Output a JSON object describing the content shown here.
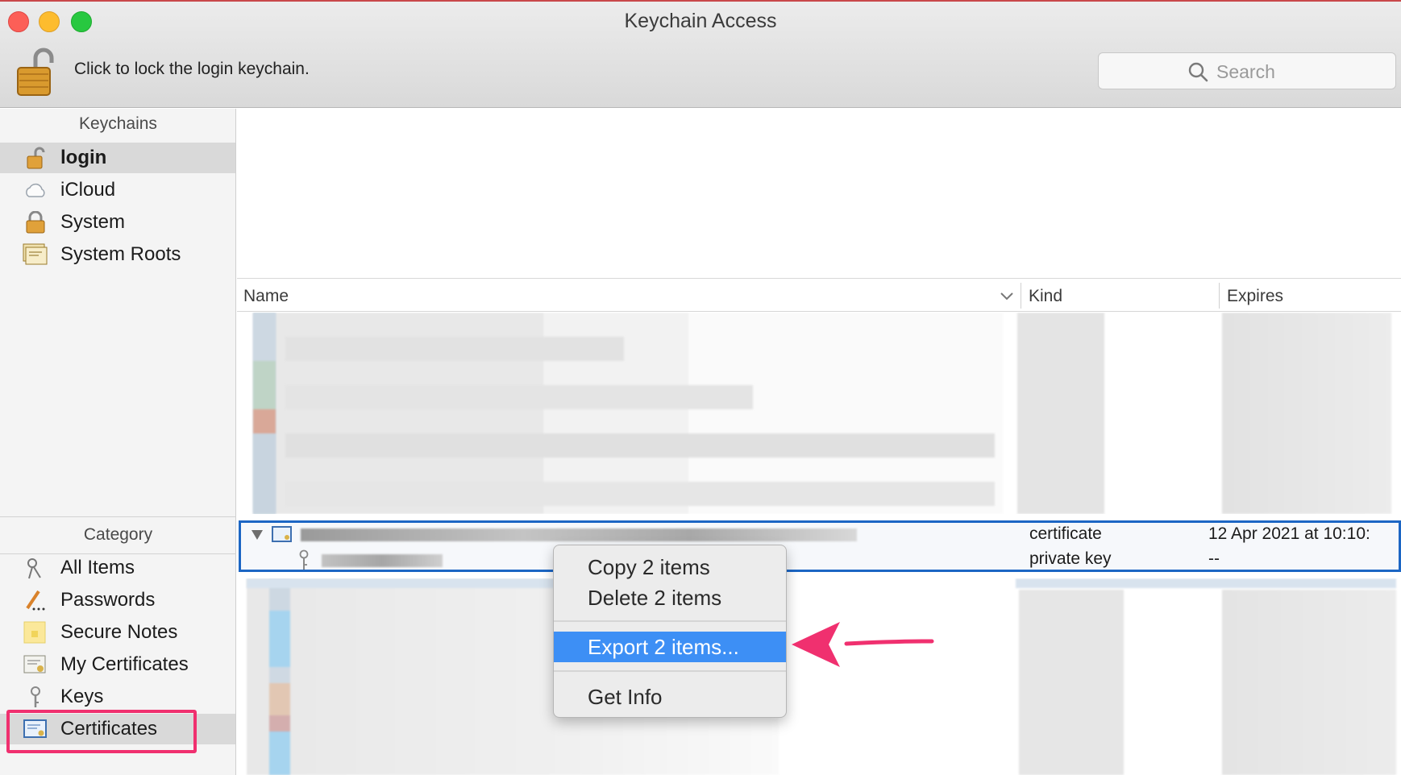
{
  "window": {
    "title": "Keychain Access"
  },
  "toolbar": {
    "lock_text": "Click to lock the login keychain.",
    "search_placeholder": "Search"
  },
  "sidebar": {
    "keychains_header": "Keychains",
    "keychains": [
      {
        "label": "login",
        "icon": "unlocked-padlock-icon",
        "active": true
      },
      {
        "label": "iCloud",
        "icon": "cloud-icon"
      },
      {
        "label": "System",
        "icon": "padlock-icon"
      },
      {
        "label": "System Roots",
        "icon": "certificate-stack-icon"
      }
    ],
    "category_header": "Category",
    "categories": [
      {
        "label": "All Items",
        "icon": "all-items-icon"
      },
      {
        "label": "Passwords",
        "icon": "pen-icon"
      },
      {
        "label": "Secure Notes",
        "icon": "note-icon"
      },
      {
        "label": "My Certificates",
        "icon": "my-certificate-icon"
      },
      {
        "label": "Keys",
        "icon": "key-icon"
      },
      {
        "label": "Certificates",
        "icon": "certificate-icon",
        "selected": true
      }
    ]
  },
  "table": {
    "columns": [
      "Name",
      "Kind",
      "Expires"
    ],
    "selected_rows": [
      {
        "kind": "certificate",
        "expires": "12 Apr 2021 at 10:10:"
      },
      {
        "kind": "private key",
        "expires": "--"
      }
    ]
  },
  "context_menu": {
    "items": [
      "Copy 2 items",
      "Delete 2 items",
      "Export 2 items...",
      "Get Info"
    ],
    "highlighted": "Export 2 items..."
  },
  "colors": {
    "selection_blue": "#1c66c4",
    "menu_highlight": "#3d8ff5",
    "annotation_pink": "#f0306f"
  }
}
